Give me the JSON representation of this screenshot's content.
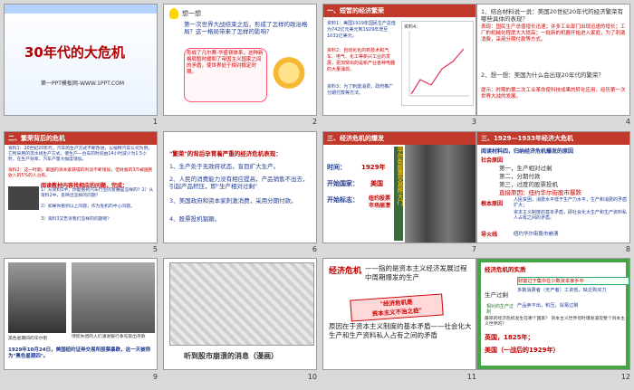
{
  "slides": [
    {
      "num": "1",
      "title": "30年代的大危机",
      "footer": "第一PPT模板网-WWW.1PPT.COM"
    },
    {
      "num": "2",
      "header": "想一想",
      "q": "第一次世界大战结束之后，形成了怎样的政治格局？这一格局带来了怎样的影响？",
      "bubble": "形成了凡尔赛-华盛顿体系，这种新格局暂时缓和了帝国主义国家之间的矛盾，使世界处于相对稳定时期。"
    },
    {
      "num": "3",
      "header": "一、短暂的经济繁荣",
      "p1": "资料1：美国1919年国民生产总值为742亿元美元到1929年增至1031亿美元。",
      "p2": "资料2：自动化化的新技术和汽车、电气、化工等新兴工业的发展，更加突出的是新产业各种电器的大量涌现。",
      "p3": "资料3：为了刺激消费，政府推广分期付款等方法。",
      "chart_label": "资料4："
    },
    {
      "num": "4",
      "q1": "1、结合材料说一说：美国20世纪20年代的经济繁荣有哪些具体的表现？",
      "a1": "表现：国民生产总值增长迅速；许多工业部门出现迅速的增长；工厂的机械化程度大大提高；一批新的机器开始进入家庭，为了刺激消费，采用分期付款等方式。",
      "q2": "2、想一想：美国为什么会出现20年代的繁荣？",
      "a2": "提示：时期的第二次工业革命使科技成果的转化应用，经历第一次世界大战的发展。"
    },
    {
      "num": "5",
      "header": "二、繁荣背后的危机",
      "p1": "资料1：20世纪20年代，汽车的生产方式不断改进，以福特汽车公司为例，它所采用的流水线生产方式，使生产一台车的时间由14小时减少为1.5小时，在生产效率，汽车产量大幅度增加。",
      "p2": "资料2：这一时期，美国的资本家获得的利润不断增加，但财富的3/5被国民收入的5%的人占有。",
      "q": "阅读教材内容找相应的问题，完成：",
      "q1": "1）从资料1中，你能看到汽车行业的发展是怎样的？2）从资料2中，反映出怎样的问题？",
      "q2": "2）如果你看到以上问题，作为危机的中心问题。",
      "q3": "3）资料3又告诉我们怎样的问题呢？"
    },
    {
      "num": "6",
      "title": "\"繁荣\"的背后孕育着严重的经济危机表现：",
      "i1": "1、生产处于无政府状态，盲目扩大生产。",
      "i2": "2、人民的消费能力没有相应提高，产品销售不出去，引起产品积压，即\"生产相对过剩\"",
      "i3": "3、美国政府和资本家刺激消费，采用分期付款。",
      "i4": "4、股票投机猖獗。"
    },
    {
      "num": "7",
      "header": "三、经济危机的爆发",
      "l1": "时间：",
      "v1": "1929年",
      "l2": "开始国家：",
      "v2": "美国",
      "l3": "开始标志：",
      "v3": "纽约股票市场崩溃",
      "vbanner": "华尔街股票交易所大门"
    },
    {
      "num": "8",
      "header": "三、1929—1933年经济大危机",
      "q": "阅读材料四，归纳经济危机爆发的原因",
      "c1": "社会原因",
      "i1": "第一，生产相对过剩",
      "i2": "第二，分期付款",
      "i3": "第三，过度的股票投机",
      "r1": "直接原因：纽约华尔街股市暴跌",
      "c2": "根本原因",
      "b1": "人民贫困，消费水平低于生产力水平，生产和消费的矛盾扩大；",
      "b2": "资本主义制度的基本矛盾，即社会化大生产和生产资料私人占有之间的矛盾。",
      "c3": "导火线",
      "b3": "纽约华尔街股市崩溃"
    },
    {
      "num": "9",
      "cap1": "黑色星期四的华尔街",
      "cap2": "惊慌失措的人们涌进银行争先取出存款",
      "cap3": "1929年10月24日，美国纽约证券交易所股票暴跌，这一天被称为\"黑色星期四\"。"
    },
    {
      "num": "10",
      "caption": "听到股市崩溃的消息（漫画）"
    },
    {
      "num": "11",
      "title": "经济危机",
      "line1": "——指的是资本主义经济发展过程中周期爆发的生产",
      "stamp1": "\"经济危机是",
      "stamp2": "资本主义不治之症\"",
      "line2": "原因在于资本主义制度的基本矛盾——社会化大生产和生产资料私人占有之间的矛盾"
    },
    {
      "num": "12",
      "header": "经济危机的实质",
      "box_label": "生产过剩",
      "note": "相对的生产过剩",
      "r1": "财富过于集中在少数资本家手中",
      "r2": "多数消费者（无产者）工资低，缺乏购买力",
      "r3": "产品卖不出，积压，贸易过剩",
      "q": "最早的经济危机发生在哪个国家？ 资本主义世界何时爆发波及整个资本主义世界的？",
      "a1": "英国，1825年；",
      "a2": "美国（一战后的1929年）"
    }
  ]
}
